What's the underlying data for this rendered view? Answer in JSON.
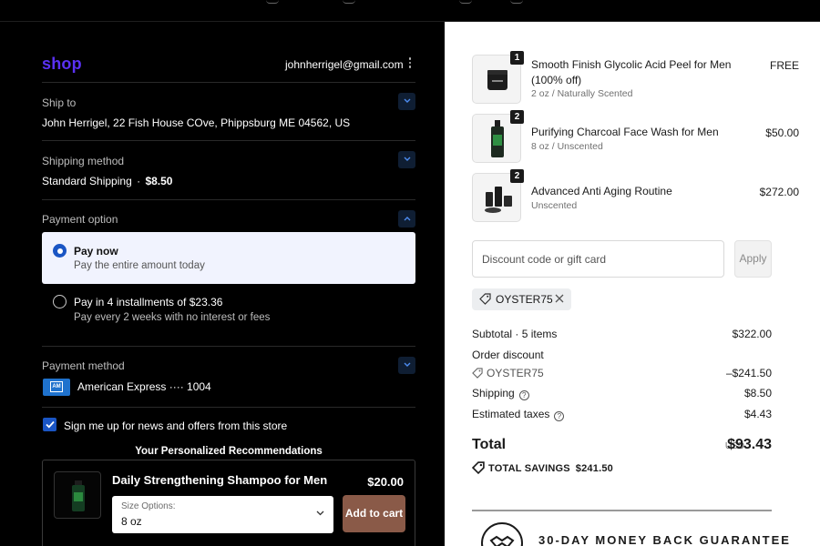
{
  "header": {
    "logo": "shop",
    "email": "johnherrigel@gmail.com"
  },
  "ship_to": {
    "label": "Ship to",
    "value": "John Herrigel, 22 Fish House COve, Phippsburg ME 04562, US"
  },
  "shipping_method": {
    "label": "Shipping method",
    "name": "Standard Shipping",
    "separator": "·",
    "price": "$8.50"
  },
  "payment_option": {
    "label": "Payment option",
    "options": [
      {
        "title": "Pay now",
        "subtitle": "Pay the entire amount today",
        "selected": true
      },
      {
        "title": "Pay in 4 installments of $23.36",
        "subtitle": "Pay every 2 weeks with no interest or fees",
        "selected": false
      }
    ]
  },
  "payment_method": {
    "label": "Payment method",
    "card_brand_icon": "amex-card-icon",
    "card_text": "American Express ···· 1004"
  },
  "newsletter": {
    "checked": true,
    "label": "Sign me up for news and offers from this store"
  },
  "recommendations": {
    "title": "Your Personalized Recommendations",
    "items": [
      {
        "name": "Daily Strengthening Shampoo for Men",
        "price": "$20.00",
        "select_label": "Size Options:",
        "select_value": "8 oz",
        "button": "Add to cart"
      }
    ]
  },
  "cart": {
    "items": [
      {
        "qty": "1",
        "name": "Smooth Finish Glycolic Acid Peel for Men (100% off)",
        "variant": "2 oz / Naturally Scented",
        "price": "FREE"
      },
      {
        "qty": "2",
        "name": "Purifying Charcoal Face Wash for Men",
        "variant": "8 oz / Unscented",
        "price": "$50.00"
      },
      {
        "qty": "2",
        "name": "Advanced Anti Aging Routine",
        "variant": "Unscented",
        "price": "$272.00"
      }
    ]
  },
  "discount": {
    "placeholder": "Discount code or gift card",
    "apply_label": "Apply",
    "applied_code": "OYSTER75"
  },
  "summary": {
    "subtotal_label": "Subtotal · 5 items",
    "subtotal_value": "$322.00",
    "order_discount_label": "Order discount",
    "discount_code": "OYSTER75",
    "discount_value": "–$241.50",
    "shipping_label": "Shipping",
    "shipping_value": "$8.50",
    "taxes_label": "Estimated taxes",
    "taxes_value": "$4.43",
    "total_label": "Total",
    "currency": "USD",
    "total_value": "$93.43",
    "savings_label": "TOTAL SAVINGS",
    "savings_value": "$241.50"
  },
  "guarantee": {
    "text": "30-DAY MONEY BACK GUARANTEE"
  },
  "colors": {
    "brand": "#5a31f4",
    "accent_blue": "#1a55c4",
    "add_to_cart": "#8a5a48",
    "left_bg": "#000000",
    "right_bg": "#ffffff"
  }
}
